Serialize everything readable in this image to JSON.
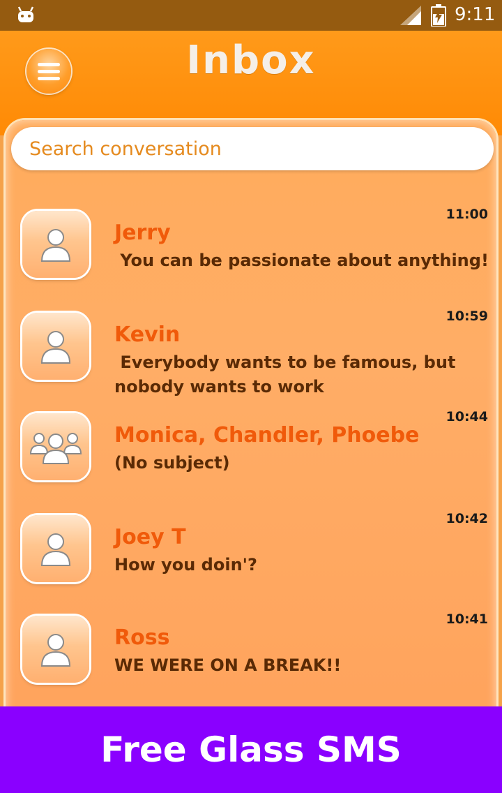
{
  "status_bar": {
    "time": "9:11"
  },
  "header": {
    "title": "Inbox"
  },
  "search": {
    "placeholder": "Search conversation"
  },
  "conversations": [
    {
      "name": "Jerry",
      "message": " You can be passionate about anything!",
      "time": "11:00",
      "avatar": "person-icon"
    },
    {
      "name": "Kevin",
      "message": " Everybody wants to be famous, but\nnobody wants to work",
      "time": "10:59",
      "avatar": "person-icon"
    },
    {
      "name": "Monica, Chandler, Phoebe",
      "message": "(No subject)",
      "time": "10:44",
      "avatar": "group-icon"
    },
    {
      "name": "Joey T",
      "message": "How you doin'?",
      "time": "10:42",
      "avatar": "person-icon"
    },
    {
      "name": "Ross",
      "message": "WE WERE ON A BREAK!!",
      "time": "10:41",
      "avatar": "person-icon"
    }
  ],
  "banner": {
    "text": "Free Glass SMS"
  },
  "colors": {
    "status_bar": "#955b10",
    "header": "#ff9a1a",
    "panel": "#ffad66",
    "name": "#f05a0a",
    "message": "#5a2a05",
    "banner": "#8a00ff"
  }
}
